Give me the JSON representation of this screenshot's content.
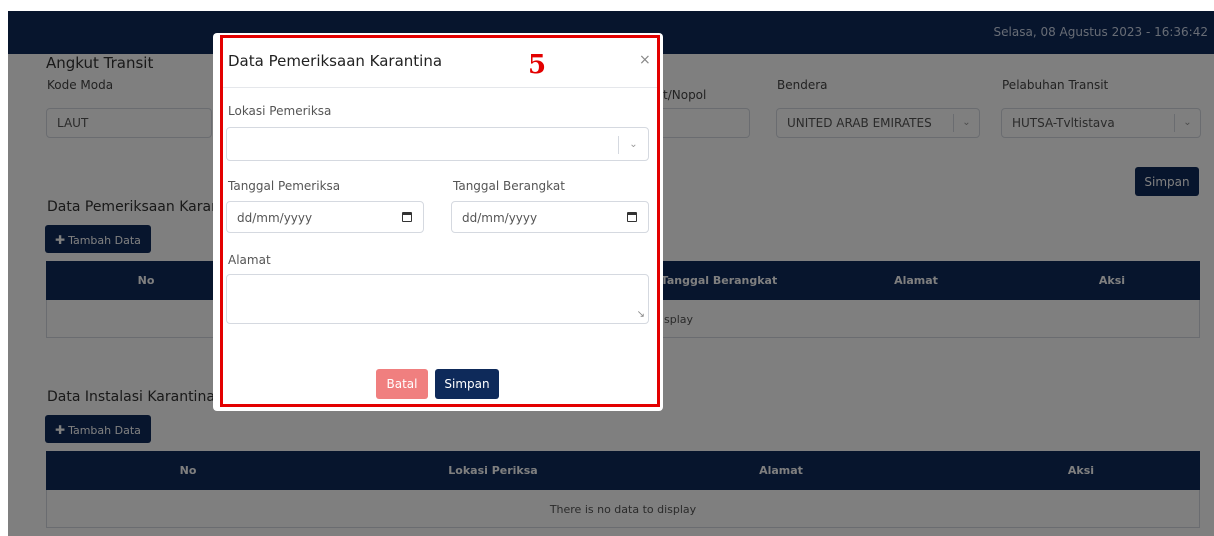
{
  "header": {
    "datetime": "Selasa, 08 Agustus 2023 - 16:36:42"
  },
  "transit_form": {
    "section_title": "Angkut Transit",
    "kode_moda_label": "Kode Moda",
    "kode_moda_value": "LAUT",
    "nopol_label": "t/Nopol",
    "bendera_label": "Bendera",
    "bendera_value": "UNITED ARAB EMIRATES",
    "pelabuhan_label": "Pelabuhan Transit",
    "pelabuhan_value": "HUTSA-Tvltistava",
    "save_label": "Simpan"
  },
  "pemeriksaan_section": {
    "title": "Data Pemeriksaan Karan",
    "add_label": "Tambah Data",
    "columns": [
      "No",
      "Tanggal Berangkat",
      "Alamat",
      "Aksi"
    ],
    "empty_text": "splay"
  },
  "instalasi_section": {
    "title": "Data Instalasi Karantina",
    "add_label": "Tambah Data",
    "columns": [
      "No",
      "Lokasi Periksa",
      "Alamat",
      "Aksi"
    ],
    "empty_text": "There is no data to display"
  },
  "modal": {
    "title": "Data Pemeriksaan Karantina",
    "close": "×",
    "step_marker": "5",
    "lokasi_label": "Lokasi Pemeriksa",
    "lokasi_value": "",
    "tanggal_pemeriksa_label": "Tanggal Pemeriksa",
    "tanggal_pemeriksa_placeholder": "dd/mm/yyyy",
    "tanggal_berangkat_label": "Tanggal Berangkat",
    "tanggal_berangkat_placeholder": "dd/mm/yyyy",
    "alamat_label": "Alamat",
    "alamat_value": "",
    "cancel_label": "Batal",
    "save_label": "Simpan"
  },
  "icons": {
    "select_arrow": "chevron-down-icon",
    "calendar": "calendar-icon",
    "plus": "plus-icon",
    "close": "close-icon",
    "resize": "resize-grip-icon"
  },
  "colors": {
    "navy": "#0e2a5a",
    "cancel": "#f07f7f",
    "highlight": "#e30000"
  }
}
